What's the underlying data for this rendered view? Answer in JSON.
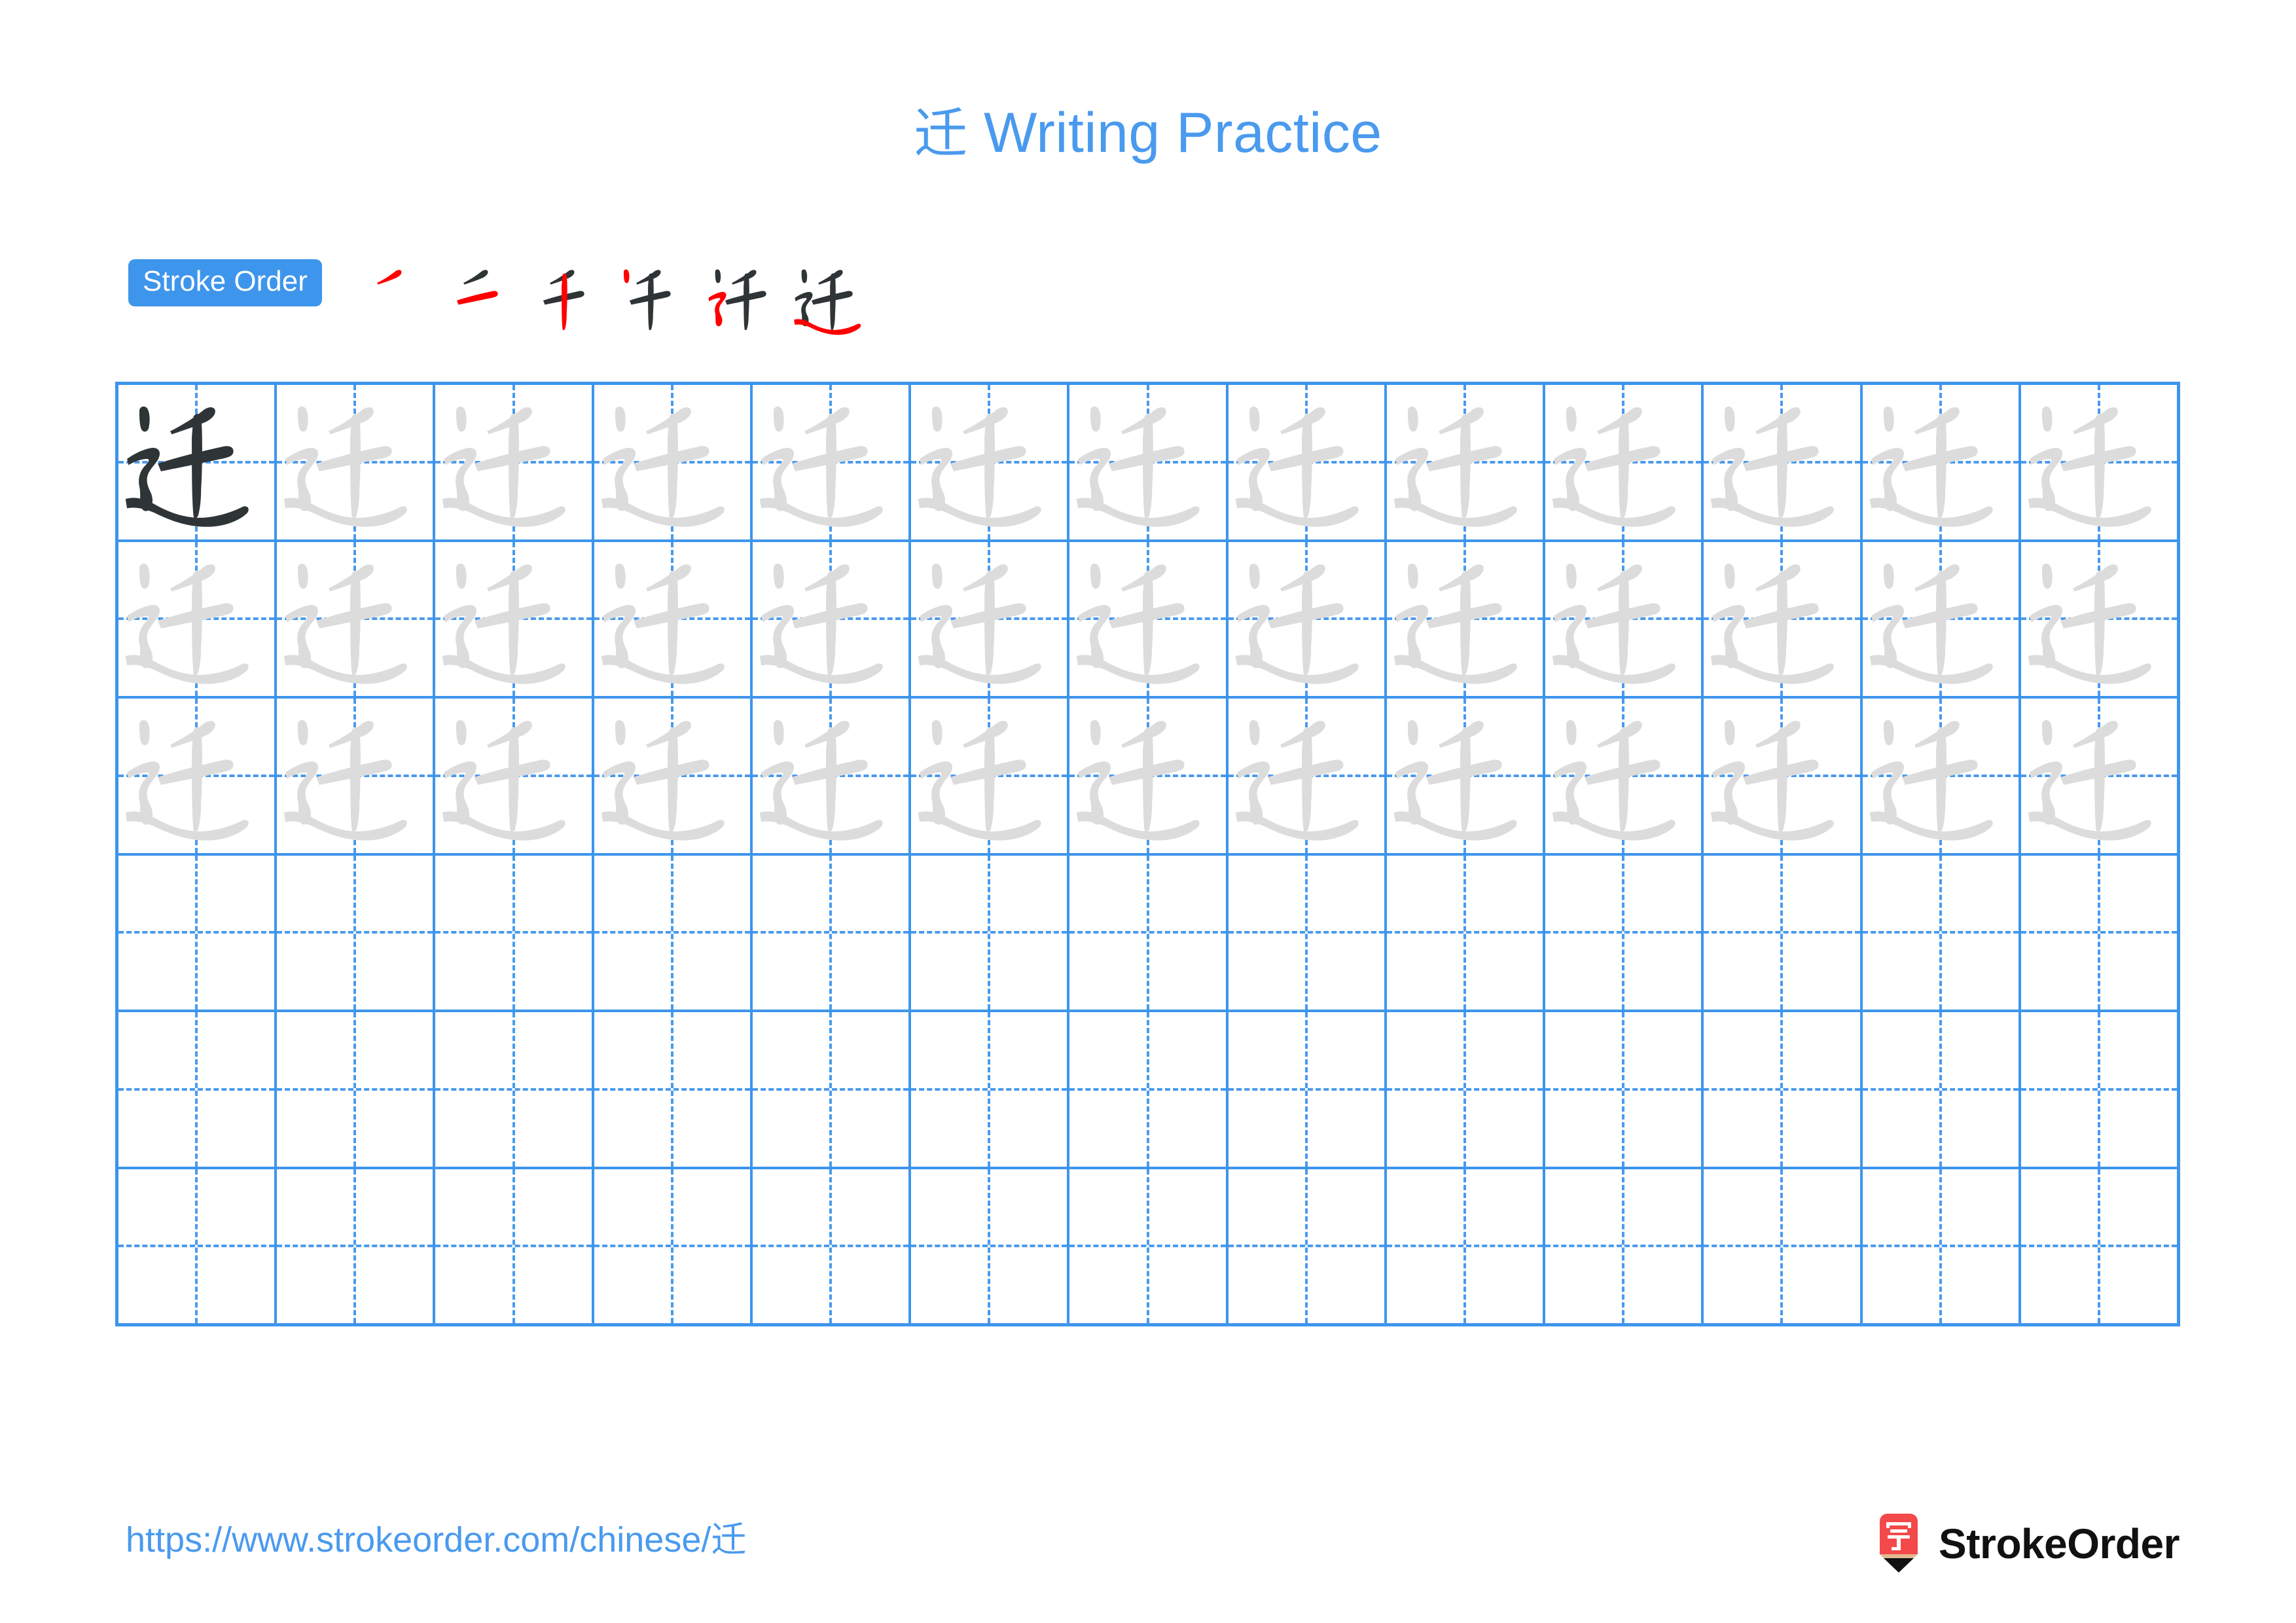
{
  "page": {
    "title_character": "迁",
    "title_text": " Writing Practice",
    "title_full": "迁 Writing Practice",
    "accent_blue": "#4a9aee",
    "grid_blue": "#3d95ec",
    "stroke_red": "#ff0000",
    "stroke_dark": "#2f3437",
    "trace_gray": "#dcdcdc"
  },
  "stroke_order": {
    "badge_label": "Stroke Order",
    "total_strokes": 6,
    "steps": [
      {
        "index": 1,
        "new_stroke": "撇 (left-falling dot)",
        "strokes_shown": 1
      },
      {
        "index": 2,
        "new_stroke": "横 (horizontal)",
        "strokes_shown": 2
      },
      {
        "index": 3,
        "new_stroke": "竖 (vertical)",
        "strokes_shown": 3
      },
      {
        "index": 4,
        "new_stroke": "点 (dot)",
        "strokes_shown": 4
      },
      {
        "index": 5,
        "new_stroke": "横折折撇 (walk radical curve)",
        "strokes_shown": 5
      },
      {
        "index": 6,
        "new_stroke": "捺 (sweeping right-falling)",
        "strokes_shown": 6
      }
    ]
  },
  "practice_grid": {
    "columns": 13,
    "rows": 6,
    "row_types": [
      "model",
      "trace",
      "trace",
      "blank",
      "blank",
      "blank"
    ],
    "model_cell_index": 0,
    "character": "迁"
  },
  "footer": {
    "url_prefix": "https://www.strokeorder.com/chinese/",
    "url_character": "迁",
    "url_full": "https://www.strokeorder.com/chinese/迁",
    "brand_name": "StrokeOrder",
    "logo_character": "字",
    "logo_body_color": "#f4494a",
    "logo_wood_color": "#e0b98f",
    "logo_tip_color": "#111111"
  }
}
